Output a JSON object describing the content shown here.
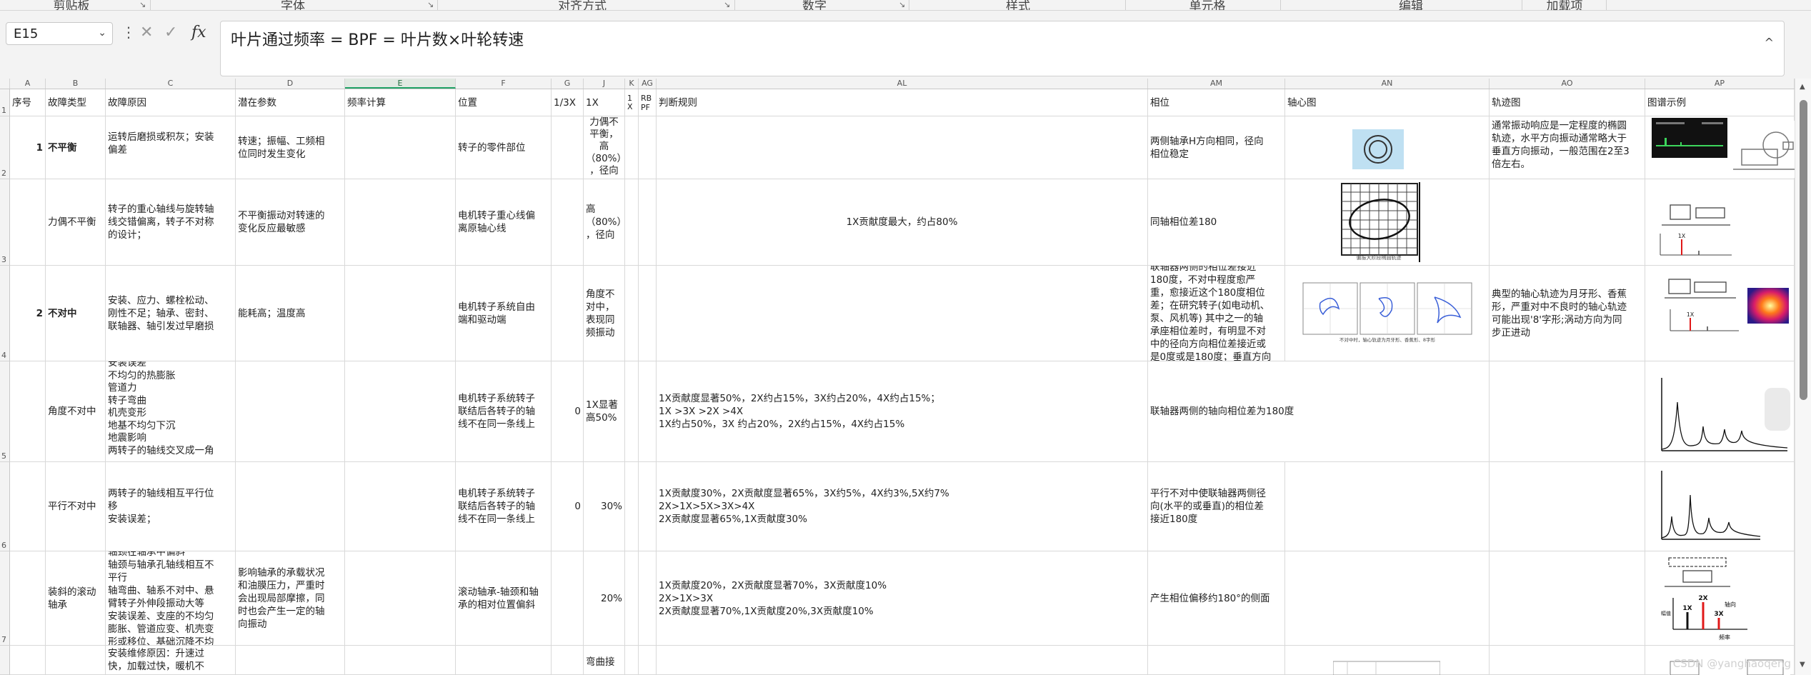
{
  "ribbon": {
    "groups": [
      "剪贴板",
      "字体",
      "对齐方式",
      "数字",
      "样式",
      "单元格",
      "编辑",
      "加载项"
    ]
  },
  "formula_bar": {
    "name_box": "E15",
    "dots": "⋮",
    "cancel_icon": "✕",
    "enter_icon": "✓",
    "fx": "fx",
    "formula": "叶片通过频率 = BPF = 叶片数×叶轮转速",
    "collapse_icon": "^"
  },
  "columns": [
    "A",
    "B",
    "C",
    "D",
    "E",
    "F",
    "G",
    "J",
    "K",
    "AG",
    "AL",
    "AM",
    "AN",
    "AO",
    "AP"
  ],
  "rows": [
    "1",
    "2",
    "3",
    "4",
    "5",
    "6",
    "7"
  ],
  "header": {
    "a": "序号",
    "b": "故障类型",
    "c": "故障原因",
    "d": "潜在参数",
    "e": "频率计算",
    "f": "位置",
    "g": "1/3X",
    "j": "1X",
    "k": "1\nX",
    "ag": "RB\nPF",
    "al": "判断规则",
    "am": "相位",
    "an": "轴心图",
    "ao": "轨迹图",
    "ap": "图谱示例"
  },
  "r2": {
    "a": "1",
    "b": "不平衡",
    "c": "运转后磨损或积灰；安装\n偏差",
    "d": "转速；振幅、工频相\n位同时发生变化",
    "f": "转子的零件部位",
    "j": "力偶不\n平衡，\n高\n（80%）\n，径向",
    "am": "两侧轴承H方向相同，径向\n相位稳定",
    "ao": "通常振动响应是一定程度的椭圆\n轨迹，水平方向振动通常略大于\n垂直方向振动，一般范围在2至3\n倍左右。"
  },
  "r3": {
    "b": "力偶不平衡",
    "c": "转子的重心轴线与旋转轴\n线交错偏离，转子不对称\n的设计；",
    "d": "不平衡振动对转速的\n变化反应最敏感",
    "f": "电机转子重心线偏\n离原轴心线",
    "j": "高\n（80%）\n，径向",
    "al": "1X贡献度最大，约占80%",
    "am": "同轴相位差180"
  },
  "r4": {
    "a": "2",
    "b": "不对中",
    "c": "安装、应力、螺栓松动、\n刚性不足；轴承、密封、\n联轴器、轴引发过早磨损",
    "d": "能耗高；温度高",
    "f": "电机转子系统自由\n端和驱动端",
    "j": "角度不\n对中，\n表现同\n频振动",
    "am": "联轴器两侧的相位差接近\n180度，不对中程度愈严\n重，愈接近这个180度相位\n差；在研究转子(如电动机、\n泵、风机等) 其中之一的轴\n承座相位差时，有明显不对\n中的径向方向相位差接近或\n是0度或是180度；垂直方向",
    "ao": "典型的轴心轨迹为月牙形、香蕉\n形，严重对中不良时的轴心轨迹\n可能出现'8'字形;涡动方向为同\n步正进动"
  },
  "r5": {
    "b": "角度不对中",
    "c": "安装误差\n不均匀的热膨胀\n管道力\n转子弯曲\n机壳变形\n地基不均匀下沉\n地震影响\n两转子的轴线交叉成一角",
    "f": "电机转子系统转子\n联结后各转子的轴\n线不在同一条线上",
    "g": "0",
    "j": "1X显著\n高50%",
    "al": "1X贡献度显著50%，2X约占15%，3X约占20%，4X约占15%；\n1X >3X >2X >4X\n1X约占50%，3X 约占20%，2X约占15%，4X约占15%",
    "am": "联轴器两侧的轴向相位差为180度"
  },
  "r6": {
    "b": "平行不对中",
    "c": "两转子的轴线相互平行位\n移\n安装误差；",
    "f": "电机转子系统转子\n联结后各转子的轴\n线不在同一条线上",
    "g": "0",
    "j": "30%",
    "al": "1X贡献度30%，2X贡献度显著65%，3X约5%，4X约3%,5X约7%\n2X>1X>5X>3X>4X\n2X贡献度显著65%,1X贡献度30%",
    "am": "平行不对中使联轴器两侧径\n向(水平的或垂直)的相位差\n接近180度"
  },
  "r7": {
    "b": "装斜的滚动\n轴承",
    "c": "轴颈在轴承中偏斜\n轴颈与轴承孔轴线相互不\n平行\n轴弯曲、轴系不对中、悬\n臂转子外伸段振动大等\n安装误差、支座的不均匀\n膨胀、管道应变、机壳变\n形或移位、基础沉降不均",
    "d": "影响轴承的承载状况\n和油膜压力，严重时\n会出现局部摩擦，同\n时也会产生一定的轴\n向振动",
    "f": "滚动轴承-轴颈和轴\n承的相对位置偏斜",
    "j": "20%",
    "al": "1X贡献度20%，2X贡献度显著70%，3X贡献度10%\n2X>1X>3X\n2X贡献度显著70%,1X贡献度20%,3X贡献度10%",
    "am": "产生相位偏移约180°的侧面"
  },
  "r8": {
    "c": "安装维修原因：升速过\n快，加载过快，暖机不",
    "j": "弯曲接"
  },
  "images": {
    "an3_caption": "偏振大阶段椭圆轨迹",
    "an4_caption": "不对中时，轴心轨迹为月牙形、香蕉形、8字形",
    "ap3_label": "1X",
    "ap4_label": "1X",
    "ap7_labels": [
      "1X",
      "2X",
      "3X"
    ],
    "ap7_axis": "频率",
    "ap7_side": "轴向",
    "ap7_y": "幅值"
  },
  "watermark": "CSDN @yanghaoqeng",
  "colors": {
    "accent": "#21a366",
    "spectrum_red": "#e01818"
  }
}
